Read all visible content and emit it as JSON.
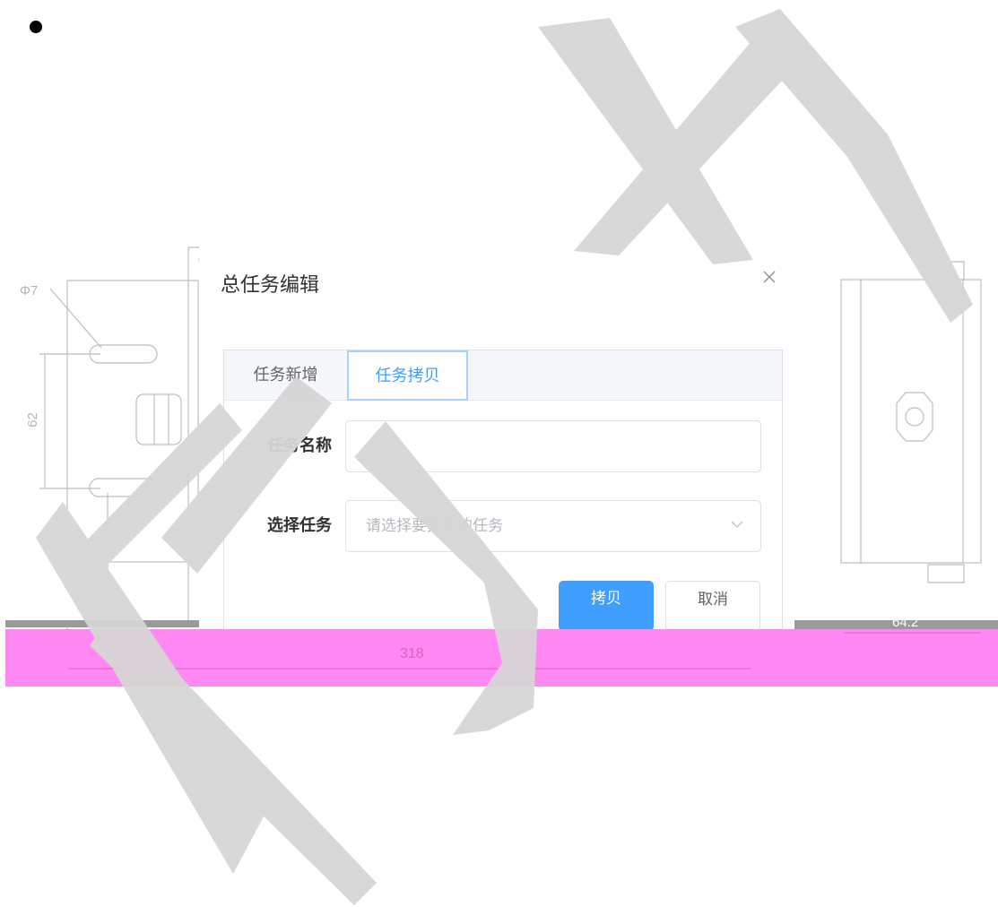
{
  "dialog": {
    "title": "总任务编辑",
    "close_icon": "close-icon"
  },
  "tabs": [
    {
      "label": "任务新增",
      "active": false
    },
    {
      "label": "任务拷贝",
      "active": true
    }
  ],
  "form": {
    "name_label": "任务名称",
    "name_value": "",
    "select_label": "选择任务",
    "select_placeholder": "请选择要拷贝的任务"
  },
  "buttons": {
    "copy_label": "拷贝",
    "cancel_label": "取消"
  },
  "drawing": {
    "label_phi": "Φ7",
    "label_62": "62",
    "label_318": "318",
    "label_64": "64.2"
  },
  "colors": {
    "primary": "#409eff",
    "band": "#ff88f2",
    "watermark": "#d6d6d6"
  }
}
